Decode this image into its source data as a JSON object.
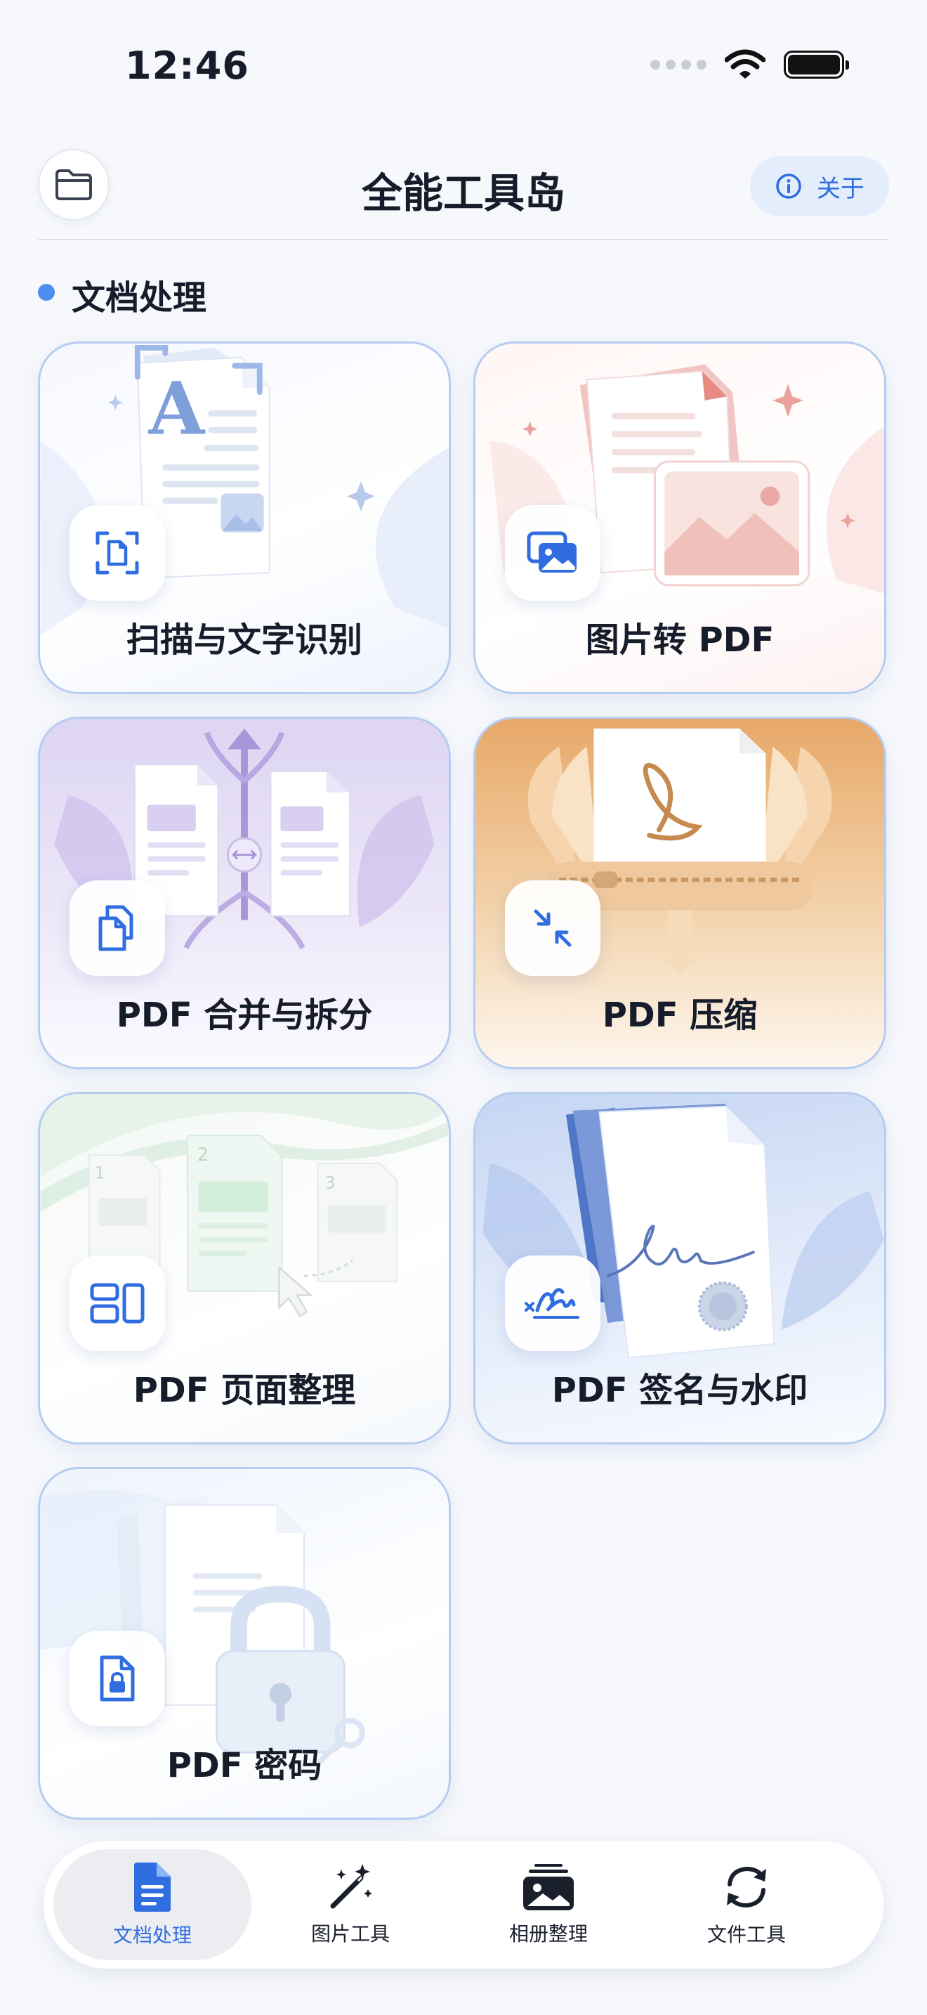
{
  "status_bar": {
    "time": "12:46"
  },
  "header": {
    "title": "全能工具岛",
    "about_label": "关于"
  },
  "section": {
    "title": "文档处理"
  },
  "cards": [
    {
      "label": "扫描与文字识别",
      "icon": "scan-document-icon"
    },
    {
      "label": "图片转 PDF",
      "icon": "images-icon"
    },
    {
      "label": "PDF 合并与拆分",
      "icon": "copy-documents-icon"
    },
    {
      "label": "PDF 压缩",
      "icon": "compress-arrows-icon"
    },
    {
      "label": "PDF 页面整理",
      "icon": "layout-blocks-icon"
    },
    {
      "label": "PDF 签名与水印",
      "icon": "signature-icon"
    },
    {
      "label": "PDF 密码",
      "icon": "locked-document-icon"
    }
  ],
  "art_text": {
    "page1": "1",
    "page2": "2",
    "page3": "3"
  },
  "tabbar": {
    "active_index": 0,
    "items": [
      {
        "label": "文档处理",
        "icon": "document-icon"
      },
      {
        "label": "图片工具",
        "icon": "magic-wand-icon"
      },
      {
        "label": "相册整理",
        "icon": "photo-album-icon"
      },
      {
        "label": "文件工具",
        "icon": "sync-arrows-icon"
      }
    ]
  },
  "colors": {
    "accent": "#2f6de0",
    "card_border": "#b6cdf0",
    "background": "#f6f8fc"
  }
}
